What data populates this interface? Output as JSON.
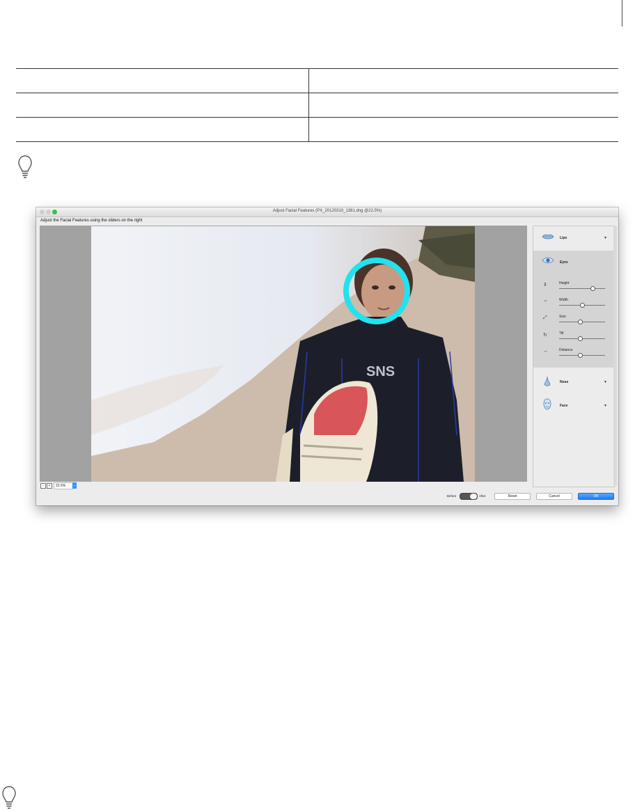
{
  "window": {
    "title": "Adjust Facial Features (PX_20120310_1381.dng @22.5%)",
    "instruction": "Adjust the Facial Features using the sliders on the right"
  },
  "canvas": {
    "zoom_out_icon": "minus-icon",
    "zoom_in_icon": "plus-icon",
    "zoom_minus": "-",
    "zoom_plus": "+",
    "zoom_value": "22.5%"
  },
  "photo": {
    "board_text": "SNS"
  },
  "panel": {
    "lips": {
      "label": "Lips",
      "arrow": "▼",
      "icon": "lips-icon"
    },
    "eyes": {
      "label": "Eyes",
      "icon": "eye-icon"
    },
    "sliders": [
      {
        "label": "Height",
        "value": 0.72
      },
      {
        "label": "Width",
        "value": 0.5
      },
      {
        "label": "Size",
        "value": 0.45
      },
      {
        "label": "Tilt",
        "value": 0.45
      },
      {
        "label": "Distance",
        "value": 0.45
      }
    ],
    "nose": {
      "label": "Nose",
      "arrow": "▼",
      "icon": "nose-icon"
    },
    "face": {
      "label": "Face",
      "arrow": "▼",
      "icon": "face-icon"
    }
  },
  "footer": {
    "before": "Before",
    "after": "After",
    "reset": "Reset",
    "cancel": "Cancel",
    "ok": "OK"
  },
  "colors": {
    "highlight_circle": "#22e2ee",
    "ok_button": "#2a86f5"
  }
}
